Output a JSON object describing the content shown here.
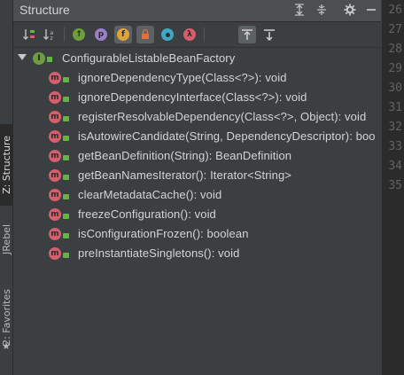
{
  "panel": {
    "title": "Structure"
  },
  "toolbar": {
    "buttons": [
      {
        "name": "sort-by-visibility-icon",
        "glyph": "↓≡"
      },
      {
        "name": "sort-alphabetically-icon",
        "glyph": "↓a"
      },
      {
        "name": "show-inherited-icon",
        "glyph": "⊕"
      },
      {
        "name": "show-properties-icon",
        "glyph": "p"
      },
      {
        "name": "show-fields-icon",
        "glyph": "f"
      },
      {
        "name": "show-non-public-icon",
        "glyph": "🔒"
      },
      {
        "name": "show-anonymous-icon",
        "glyph": "●"
      },
      {
        "name": "show-lambdas-icon",
        "glyph": "λ"
      },
      {
        "name": "autoscroll-to-source-icon",
        "glyph": "↥"
      },
      {
        "name": "autoscroll-from-source-icon",
        "glyph": "↧"
      }
    ]
  },
  "tree": {
    "root": {
      "label": "ConfigurableListableBeanFactory",
      "icon_letter": "I"
    },
    "method_icon_letter": "m",
    "methods": [
      "ignoreDependencyType(Class<?>): void",
      "ignoreDependencyInterface(Class<?>): void",
      "registerResolvableDependency(Class<?>, Object): void",
      "isAutowireCandidate(String, DependencyDescriptor): boo",
      "getBeanDefinition(String): BeanDefinition",
      "getBeanNamesIterator(): Iterator<String>",
      "clearMetadataCache(): void",
      "freezeConfiguration(): void",
      "isConfigurationFrozen(): boolean",
      "preInstantiateSingletons(): void"
    ]
  },
  "side_tabs": {
    "structure": "Z: Structure",
    "jrebel": "JRebel",
    "favorites": "2: Favorites"
  },
  "gutter": {
    "line_numbers": [
      "26",
      "27",
      "28",
      "29",
      "30",
      "31",
      "32",
      "33",
      "34",
      "35"
    ]
  },
  "colors": {
    "background": "#3c3f41",
    "method_icon": "#d65e6b",
    "interface_icon": "#6e9d3d",
    "public_marker": "#62b543"
  }
}
